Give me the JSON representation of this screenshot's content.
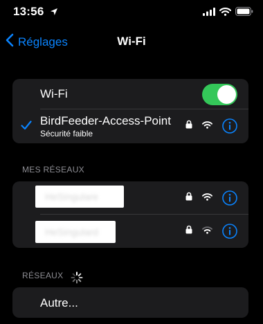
{
  "status": {
    "time": "13:56"
  },
  "nav": {
    "back_label": "Réglages",
    "title": "Wi-Fi"
  },
  "wifi_toggle": {
    "label": "Wi-Fi",
    "on": true
  },
  "connected": {
    "name": "BirdFeeder-Access-Point",
    "subtitle": "Sécurité faible"
  },
  "my_networks": {
    "header": "MES RÉSEAUX",
    "items": [
      {
        "name": "HeSingulare"
      },
      {
        "name": "HeSingulard"
      }
    ]
  },
  "networks": {
    "header": "RÉSEAUX",
    "other_label": "Autre..."
  },
  "colors": {
    "accent": "#0a84ff",
    "toggle_on": "#34c759",
    "group_bg": "#1c1c1e"
  }
}
